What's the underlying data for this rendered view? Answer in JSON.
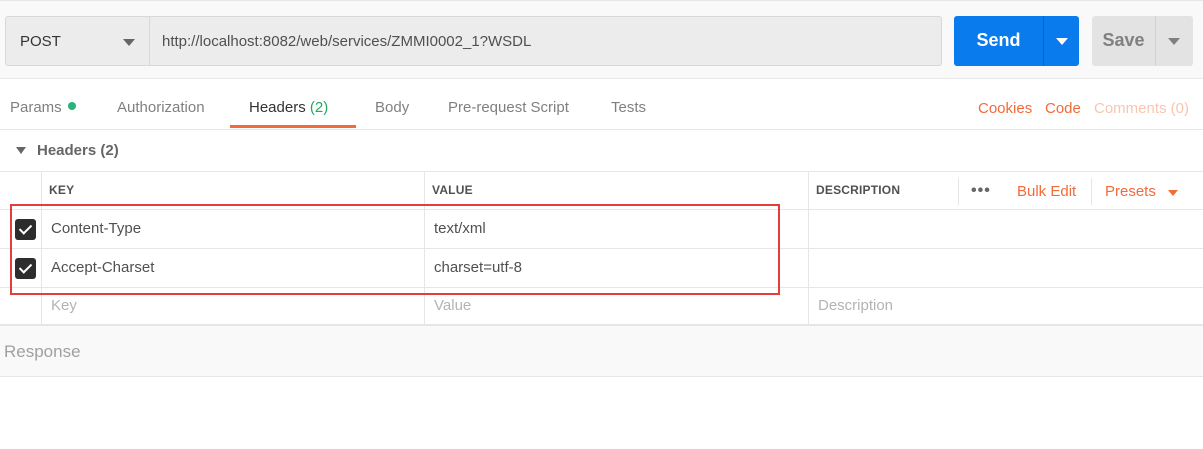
{
  "request": {
    "method": "POST",
    "url": "http://localhost:8082/web/services/ZMMI0002_1?WSDL",
    "send_label": "Send",
    "save_label": "Save"
  },
  "tabs": {
    "params": "Params",
    "authorization": "Authorization",
    "headers": "Headers",
    "headers_count": "(2)",
    "body": "Body",
    "prerequest": "Pre-request Script",
    "tests": "Tests"
  },
  "right_links": {
    "cookies": "Cookies",
    "code": "Code",
    "comments": "Comments (0)"
  },
  "section": {
    "title": "Headers (2)"
  },
  "table": {
    "columns": {
      "key": "KEY",
      "value": "VALUE",
      "description": "DESCRIPTION"
    },
    "dots": "•••",
    "bulk_edit": "Bulk Edit",
    "presets": "Presets",
    "rows": [
      {
        "key": "Content-Type",
        "value": "text/xml",
        "checked": true
      },
      {
        "key": "Accept-Charset",
        "value": "charset=utf-8",
        "checked": true
      }
    ],
    "placeholders": {
      "key": "Key",
      "value": "Value",
      "description": "Description"
    }
  },
  "response": {
    "label": "Response"
  },
  "colors": {
    "accent": "#f26b3a",
    "send": "#097bed",
    "dot_green": "#26b47a",
    "highlight": "#e33e3e"
  },
  "icons": [
    "caret-down-icon",
    "checkbox-checked-icon",
    "more-dots-icon"
  ]
}
